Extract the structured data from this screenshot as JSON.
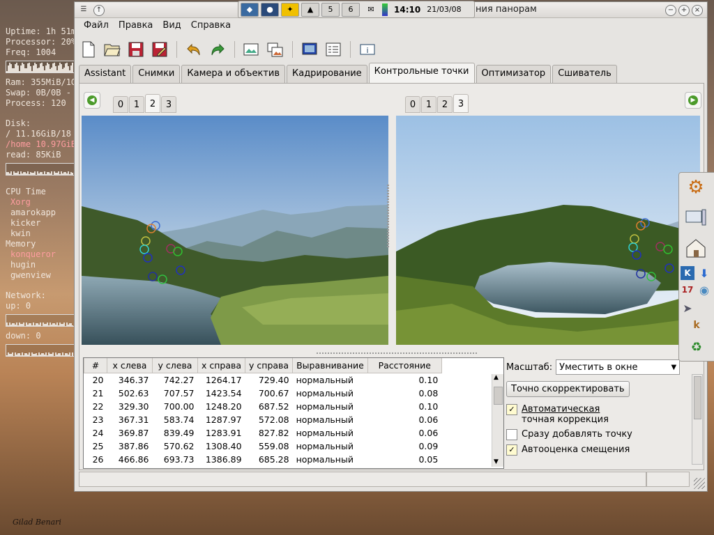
{
  "monitor": {
    "uptime": "Uptime: 1h 51m",
    "processor": "Processor: 20%",
    "freq": "Freq: 1004",
    "ram": "Ram: 355MiB/1G",
    "swap": "Swap: 0B/0B -",
    "process": "Process: 120",
    "disk_label": "Disk:",
    "disk_root": "/ 11.16GiB/18",
    "disk_home": "/home 10.97GiB",
    "read": "read: 85KiB",
    "cpu_label": "CPU Time",
    "cpu_procs": [
      "Xorg",
      "amarokapp",
      "kicker",
      "kwin"
    ],
    "mem_label": "Memory",
    "mem_procs": [
      "konqueror",
      "hugin",
      "gwenview"
    ],
    "network_label": "Network:",
    "up": "up: 0",
    "down": "down: 0"
  },
  "signature": "Gilad Benari",
  "panel": {
    "desktops": [
      "5",
      "6"
    ],
    "clock": "14:10",
    "date": "21/03/08"
  },
  "window": {
    "title": "ния панорам"
  },
  "menu": [
    {
      "label": "Файл"
    },
    {
      "label": "Правка"
    },
    {
      "label": "Вид"
    },
    {
      "label": "Справка"
    }
  ],
  "tabs": [
    {
      "label": "Assistant"
    },
    {
      "label": "Снимки"
    },
    {
      "label": "Камера и объектив"
    },
    {
      "label": "Кадрирование"
    },
    {
      "label": "Контрольные точки",
      "active": true
    },
    {
      "label": "Оптимизатор"
    },
    {
      "label": "Сшиватель"
    }
  ],
  "left_image_tabs": [
    "0",
    "1",
    "2",
    "3"
  ],
  "left_selected": "2",
  "right_image_tabs": [
    "0",
    "1",
    "2",
    "3"
  ],
  "right_selected": "3",
  "table": {
    "headers": [
      "#",
      "x слева",
      "y слева",
      "x справа",
      "y справа",
      "Выравнивание",
      "Расстояние"
    ],
    "rows": [
      [
        "20",
        "346.37",
        "742.27",
        "1264.17",
        "729.40",
        "нормальный",
        "0.10"
      ],
      [
        "21",
        "502.63",
        "707.57",
        "1423.54",
        "700.67",
        "нормальный",
        "0.08"
      ],
      [
        "22",
        "329.30",
        "700.00",
        "1248.20",
        "687.52",
        "нормальный",
        "0.10"
      ],
      [
        "23",
        "367.31",
        "583.74",
        "1287.97",
        "572.08",
        "нормальный",
        "0.06"
      ],
      [
        "24",
        "369.87",
        "839.49",
        "1283.91",
        "827.82",
        "нормальный",
        "0.06"
      ],
      [
        "25",
        "387.86",
        "570.62",
        "1308.40",
        "559.08",
        "нормальный",
        "0.09"
      ],
      [
        "26",
        "466.86",
        "693.73",
        "1386.89",
        "685.28",
        "нормальный",
        "0.05"
      ]
    ]
  },
  "controls": {
    "zoom_label": "Масштаб:",
    "zoom_value": "Уместить в окне",
    "fine_tune_button": "Точно скорректировать",
    "auto_fine_tune_line1": "Автоматическая",
    "auto_fine_tune_line2": "точная коррекция",
    "auto_add": "Сразу добавлять точку",
    "auto_estimate": "Автооценка смещения",
    "auto_fine_tune_checked": true,
    "auto_add_checked": false,
    "auto_estimate_checked": true
  },
  "icons": {
    "new": "new-document-icon",
    "open": "open-folder-icon",
    "save": "save-icon",
    "save_as": "save-as-icon",
    "undo": "undo-icon",
    "redo": "redo-icon",
    "add_image": "add-image-icon",
    "add_series": "add-series-icon",
    "preview": "preview-icon",
    "list": "list-icon",
    "info": "info-icon"
  }
}
